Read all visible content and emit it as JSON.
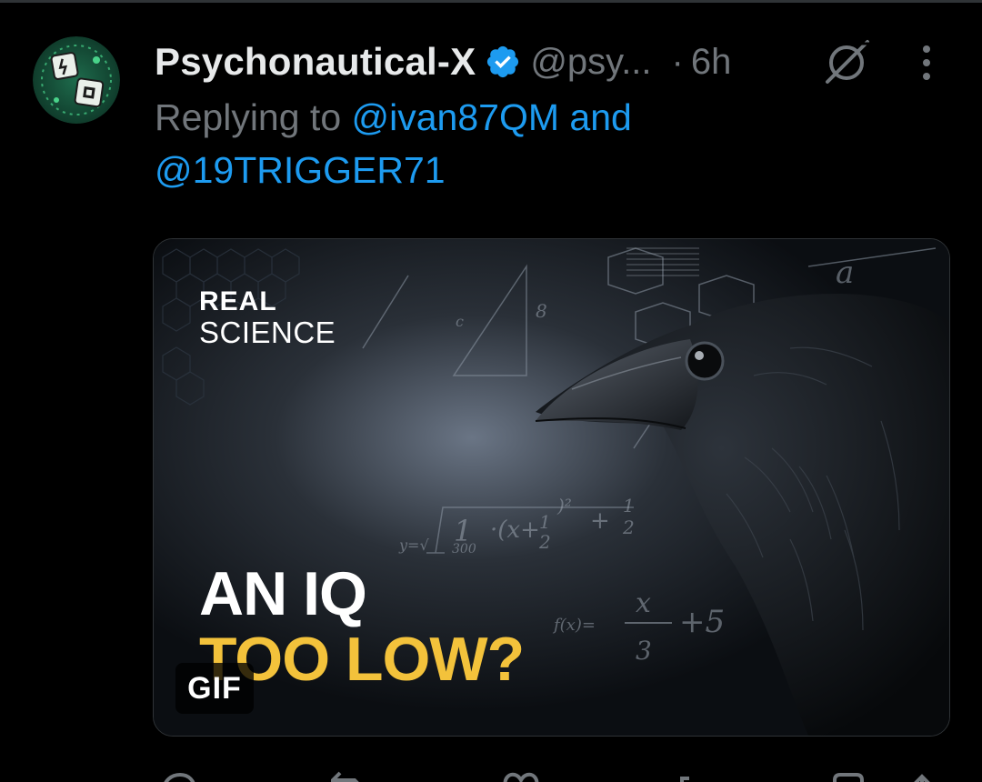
{
  "tweet": {
    "display_name": "Psychonautical-X",
    "handle": "@psy...",
    "separator": "·",
    "time": "6h",
    "replying_prefix": "Replying to ",
    "mention_1": "@ivan87QM",
    "joiner": " and",
    "mention_2": "@19TRIGGER71"
  },
  "media": {
    "type_badge": "GIF",
    "brand_line_1": "REAL",
    "brand_line_2": "SCIENCE",
    "headline_line_1": "AN IQ",
    "headline_line_2": "TOO LOW?"
  },
  "icons": {
    "verified": "verified-badge-icon",
    "grok": "grok-icon",
    "more": "more-vertical-icon",
    "reply": "reply-icon",
    "repost": "repost-icon",
    "like": "like-icon",
    "views": "views-icon",
    "bookmark": "bookmark-icon",
    "share": "share-icon"
  },
  "colors": {
    "background": "#000000",
    "primary_text": "#e7e9ea",
    "secondary_text": "#71767b",
    "link": "#1d9bf0",
    "verified": "#1d9bf0",
    "headline_yellow": "#f3c23b"
  }
}
